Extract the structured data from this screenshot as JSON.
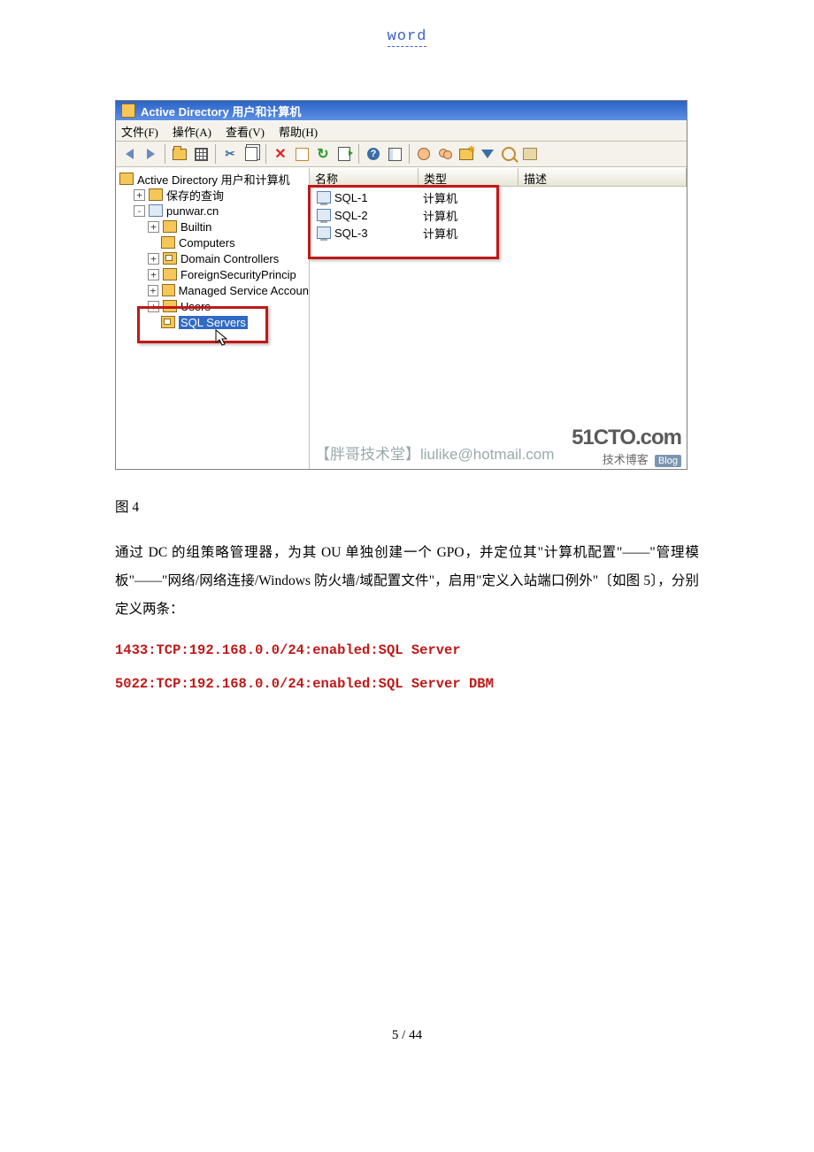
{
  "header": {
    "word": "word"
  },
  "screenshot": {
    "title": "Active Directory 用户和计算机",
    "menubar": [
      "文件(F)",
      "操作(A)",
      "查看(V)",
      "帮助(H)"
    ],
    "tree": {
      "root": "Active Directory 用户和计算机",
      "items": [
        {
          "label": "保存的查询",
          "indent": 1,
          "exp": "+",
          "icon": "folder"
        },
        {
          "label": "punwar.cn",
          "indent": 1,
          "exp": "-",
          "icon": "domain"
        },
        {
          "label": "Builtin",
          "indent": 2,
          "exp": "+",
          "icon": "folder"
        },
        {
          "label": "Computers",
          "indent": 2,
          "exp": "",
          "icon": "folder"
        },
        {
          "label": "Domain Controllers",
          "indent": 2,
          "exp": "+",
          "icon": "ou"
        },
        {
          "label": "ForeignSecurityPrincip",
          "indent": 2,
          "exp": "+",
          "icon": "folder"
        },
        {
          "label": "Managed Service Accoun",
          "indent": 2,
          "exp": "+",
          "icon": "folder"
        },
        {
          "label": "Users",
          "indent": 2,
          "exp": "+",
          "icon": "folder"
        },
        {
          "label": "SQL Servers",
          "indent": 2,
          "exp": "",
          "icon": "ou",
          "selected": true
        }
      ]
    },
    "list": {
      "columns": [
        "名称",
        "类型",
        "描述"
      ],
      "rows": [
        {
          "name": "SQL-1",
          "type": "计算机"
        },
        {
          "name": "SQL-2",
          "type": "计算机"
        },
        {
          "name": "SQL-3",
          "type": "计算机"
        }
      ]
    },
    "watermark_left": "【胖哥技术堂】liulike@hotmail.com",
    "watermark_right_big": "51CTO.com",
    "watermark_right_sub": "技术博客",
    "watermark_right_blog": "Blog"
  },
  "caption": "图 4",
  "paragraph": "通过 DC 的组策略管理器，为其 OU 单独创建一个 GPO，并定位其\"计算机配置\"——\"管理模板\"——\"网络/网络连接/Windows 防火墙/域配置文件\"，启用\"定义入站端口例外\"〔如图 5〕，分别定义两条：",
  "code1": "1433:TCP:192.168.0.0/24:enabled:SQL Server",
  "code2": "5022:TCP:192.168.0.0/24:enabled:SQL Server DBM",
  "footer": "5 / 44"
}
